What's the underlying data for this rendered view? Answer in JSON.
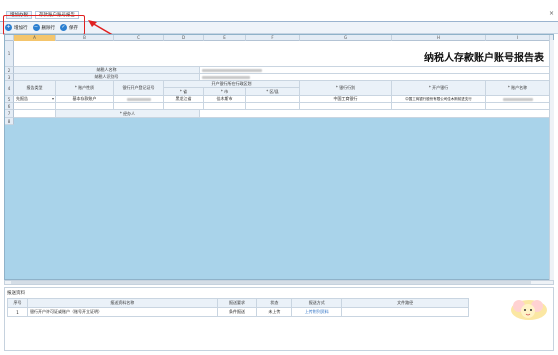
{
  "tabs": [
    {
      "label": "增加办税"
    },
    {
      "label": "存款账户账号报告"
    }
  ],
  "toolbar": {
    "add_row": "增加行",
    "delete_row": "删除行",
    "save": "保存"
  },
  "columns": [
    "A",
    "B",
    "C",
    "D",
    "E",
    "F",
    "G",
    "H",
    "I"
  ],
  "report": {
    "title": "纳税人存款账户账号报告表",
    "taxpayer_name_label": "纳税人名称",
    "taxpayer_id_label": "纳税人识别号",
    "headers": {
      "report_type": "报告类型",
      "account_nature": "* 账户性质",
      "bank_permit": "银行开户登记证号",
      "location_group": "开户银行所在行政区划",
      "province": "* 省",
      "city": "* 市",
      "district": "* 区/县",
      "bank_type": "* 银行行别",
      "bank_name": "* 开户银行",
      "account_name": "* 账户名称"
    },
    "row": {
      "report_type": "先报告",
      "account_nature": "基本存款账户",
      "province": "黑龙江省",
      "city": "佳木斯市",
      "bank_type": "中国工商银行",
      "bank_name": "中国工商银行股份有限公司佳木斯前进支行"
    },
    "agent_label": "* 经办人"
  },
  "row_numbers": [
    "1",
    "2",
    "3",
    "4",
    "5",
    "6",
    "7",
    "8"
  ],
  "materials": {
    "title": "报送资料",
    "headers": [
      "序号",
      "报送资料名称",
      "报送要求",
      "状态",
      "报送方式",
      "文件路径"
    ],
    "rows": [
      {
        "no": "1",
        "name": "银行开户许可证或账户（账号开立证明）",
        "requirement": "条件报送",
        "status": "未上传",
        "method": "上传附列资料",
        "path": ""
      }
    ]
  },
  "colors": {
    "sheet_bg": "#a9d3ea",
    "accent": "#2c7fd0",
    "highlight": "#e02020"
  }
}
